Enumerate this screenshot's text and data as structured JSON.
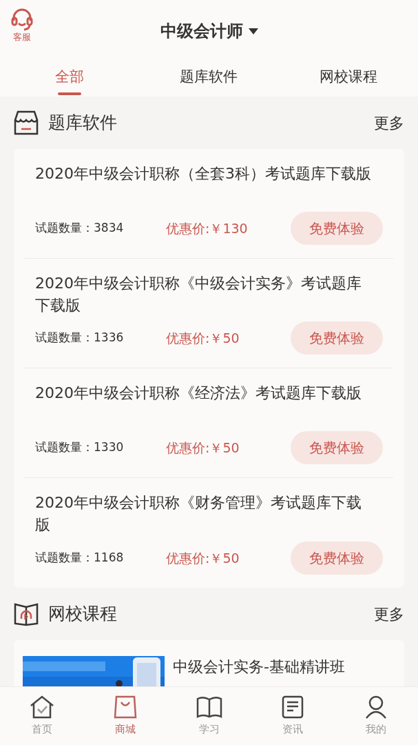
{
  "header": {
    "service_label": "客服",
    "title": "中级会计师"
  },
  "tabs": [
    {
      "label": "全部",
      "selected": true
    },
    {
      "label": "题库软件",
      "selected": false
    },
    {
      "label": "网校课程",
      "selected": false
    }
  ],
  "software_section": {
    "title": "题库软件",
    "more": "更多",
    "items": [
      {
        "title": "2020年中级会计职称（全套3科）考试题库下载版",
        "count": "试题数量：3834",
        "price": "优惠价:￥130",
        "button": "免费体验"
      },
      {
        "title": "2020年中级会计职称《中级会计实务》考试题库下载版",
        "count": "试题数量：1336",
        "price": "优惠价:￥50",
        "button": "免费体验"
      },
      {
        "title": "2020年中级会计职称《经济法》考试题库下载版",
        "count": "试题数量：1330",
        "price": "优惠价:￥50",
        "button": "免费体验"
      },
      {
        "title": "2020年中级会计职称《财务管理》考试题库下载版",
        "count": "试题数量：1168",
        "price": "优惠价:￥50",
        "button": "免费体验"
      }
    ]
  },
  "course_section": {
    "title": "网校课程",
    "more": "更多",
    "items": [
      {
        "kind": "picture",
        "title": "中级会计实务-基础精讲班"
      }
    ]
  },
  "bottom_nav": [
    {
      "label": "首页",
      "selected": false
    },
    {
      "label": "商城",
      "selected": true
    },
    {
      "label": "学习",
      "selected": false
    },
    {
      "label": "资讯",
      "selected": false
    },
    {
      "label": "我的",
      "selected": false
    }
  ]
}
